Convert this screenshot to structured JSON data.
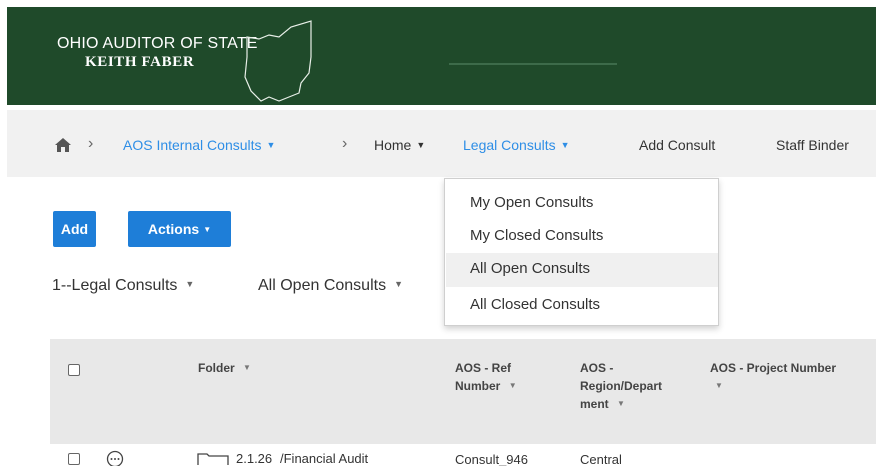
{
  "header": {
    "org_line1": "OHIO AUDITOR OF STATE",
    "org_line2": "KEITH FABER"
  },
  "breadcrumb": {
    "home_icon": "home-icon",
    "site": "AOS Internal Consults",
    "home": "Home",
    "legal_consults": "Legal Consults",
    "add_consult": "Add Consult",
    "staff_binder": "Staff Binder"
  },
  "toolbar": {
    "add_label": "Add",
    "actions_label": "Actions"
  },
  "filters": {
    "library": "1--Legal Consults",
    "view": "All Open Consults"
  },
  "dropdown": {
    "items": [
      "My Open Consults",
      "My Closed Consults",
      "All Open Consults",
      "All Closed Consults"
    ],
    "highlighted": "All Open Consults"
  },
  "table": {
    "columns": {
      "folder": "Folder",
      "ref_number": [
        "AOS - Ref",
        "Number"
      ],
      "region": [
        "AOS -",
        "Region/Depart",
        "ment"
      ],
      "project_number": "AOS - Project Number"
    },
    "rows": [
      {
        "folder_num": "2.1.26",
        "folder_name": "/Financial Audit",
        "ref": "Consult_946",
        "region": "Central"
      }
    ]
  },
  "colors": {
    "header_bg": "#1f4a2a",
    "link": "#2e8ee6",
    "primary_button": "#1e7ed8",
    "highlight": "#fff200"
  }
}
